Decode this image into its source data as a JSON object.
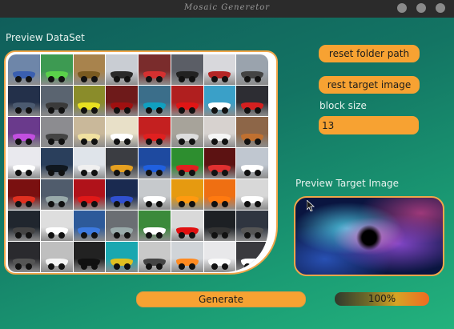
{
  "window": {
    "title": "Mosaic Generetor"
  },
  "dataset_label": "Preview DataSet",
  "buttons": {
    "reset_folder": "reset folder path",
    "reset_target": "rest target image",
    "generate": "Generate"
  },
  "block_size": {
    "label": "block size",
    "value": "13"
  },
  "target_label": "Preview Target Image",
  "progress": {
    "value": 1.0,
    "text": "100%"
  },
  "accent_color": "#f7a232",
  "dataset_tile_colors": [
    [
      "#6e86a9",
      "#3d9a52",
      "#a8834d",
      "#c9cdd3",
      "#7a2c2c",
      "#5b5e66",
      "#d8d8dc",
      "#9aa3ad"
    ],
    [
      "#23304a",
      "#5a6470",
      "#8a8c2a",
      "#6e1a1a",
      "#3b6e8a",
      "#b01f1f",
      "#3aa0c8",
      "#2d2d33"
    ],
    [
      "#6a3a8c",
      "#8c8c90",
      "#c9b89a",
      "#e8e0c8",
      "#c42020",
      "#a7a39a",
      "#d7d2cf",
      "#8d6648"
    ],
    [
      "#e9e9ee",
      "#2a3f5c",
      "#dfe4ea",
      "#3b3d42",
      "#1e4aa0",
      "#2d8e2f",
      "#5c1212",
      "#c0c7d0"
    ],
    [
      "#7a1010",
      "#505c6c",
      "#b0121a",
      "#1a2a50",
      "#c6c9cc",
      "#e69a10",
      "#ef6f12",
      "#d8d8d8"
    ],
    [
      "#20262e",
      "#dedede",
      "#2d5a9a",
      "#6a6e73",
      "#3b8a3a",
      "#d9d9d9",
      "#1d2024",
      "#2f3540"
    ],
    [
      "#2a2a2e",
      "#bfbfbf",
      "#222",
      "#1aa7b0",
      "#c9c9c9",
      "#d0d4d8",
      "#e8e8ea",
      "#3a3a3e"
    ]
  ],
  "dataset_car_colors": [
    [
      "#3a5fb0",
      "#5ad14a",
      "#7a5a20",
      "#2a2a2a",
      "#d43030",
      "#222",
      "#b52525",
      "#444"
    ],
    [
      "#4b5a70",
      "#3a3a3a",
      "#e8e020",
      "#a01010",
      "#10a0c0",
      "#e01515",
      "#ffffff",
      "#d42020"
    ],
    [
      "#c24fe0",
      "#444",
      "#f0e0a0",
      "#ffffff",
      "#e02020",
      "#ddd",
      "#f5f5f5",
      "#c07030"
    ],
    [
      "#ffffff",
      "#101820",
      "#f0f0f0",
      "#e6a020",
      "#2060e0",
      "#e02020",
      "#e03030",
      "#ffffff"
    ],
    [
      "#e03020",
      "#9aa",
      "#e01818",
      "#3050d0",
      "#ffffff",
      "#ff9a10",
      "#ff7a10",
      "#ffffff"
    ],
    [
      "#444",
      "#ffffff",
      "#3d7ae0",
      "#9aa",
      "#ffffff",
      "#e01010",
      "#333",
      "#555"
    ],
    [
      "#555",
      "#f5f5f5",
      "#111",
      "#e0c020",
      "#444",
      "#ff8a20",
      "#fafafa",
      "#ffffff"
    ]
  ]
}
